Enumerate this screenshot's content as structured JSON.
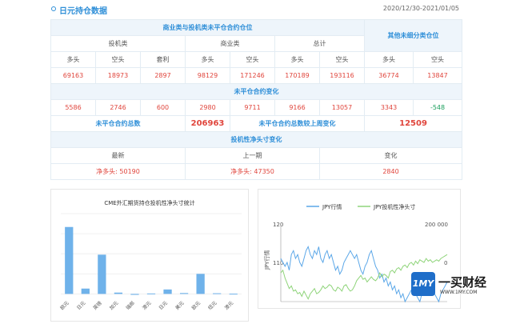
{
  "header": {
    "title": "日元持仓数据",
    "date_range": "2020/12/30-2021/01/05"
  },
  "table": {
    "group_title": "商业类与投机类未平仓合约仓位",
    "other_title": "其他未细分类仓位",
    "col_groups": [
      "投机类",
      "商业类",
      "总计"
    ],
    "sub_headers": [
      "多头",
      "空头",
      "套利",
      "多头",
      "空头",
      "多头",
      "空头",
      "多头",
      "空头"
    ],
    "values": [
      "69163",
      "18973",
      "2897",
      "98129",
      "171246",
      "170189",
      "193116",
      "36774",
      "13847"
    ],
    "change_title": "未平仓合约变化",
    "changes": [
      "5586",
      "2746",
      "600",
      "2980",
      "9711",
      "9166",
      "13057",
      "3343",
      "-548"
    ],
    "total_label": "未平仓合约总数",
    "total_value": "206963",
    "weekly_label": "未平仓合约总数较上周变化",
    "weekly_value": "12509",
    "spec_title": "投机性净头寸变化",
    "spec_headers": [
      "最新",
      "上一期",
      "变化"
    ],
    "spec_latest": "净多头: 50190",
    "spec_prev": "净多头: 47350",
    "spec_change": "2840"
  },
  "bar_chart": {
    "title": "CME外汇期货持仓投机性净头寸统计",
    "chart_data": {
      "type": "bar",
      "title": "CME外汇期货持仓投机性净头寸统计",
      "categories": [
        "欧元",
        "日元",
        "英镑",
        "加元",
        "瑞郎",
        "澳元",
        "日元",
        "美元",
        "欧元",
        "纽元",
        "澳元"
      ],
      "values": [
        150000,
        12000,
        88000,
        3000,
        -2000,
        1000,
        10000,
        2000,
        45000,
        1500,
        500
      ],
      "ylim": [
        -10000,
        180000
      ]
    }
  },
  "line_chart": {
    "legend": [
      "JPY行情",
      "JPY投机性净头寸"
    ],
    "left_ticks": [
      "120",
      "110"
    ],
    "right_ticks": [
      "200 000",
      "0"
    ],
    "left_axis_label": "JPY行情",
    "colors": {
      "jpy": "#5ba7e8",
      "net": "#8fd47a"
    },
    "chart_data": {
      "type": "line",
      "series": [
        {
          "name": "JPY行情",
          "values": [
            111,
            110,
            109,
            110,
            108,
            112,
            113,
            111,
            112,
            110,
            109,
            111,
            113,
            114,
            112,
            111,
            113,
            112,
            114,
            111,
            110,
            112,
            113,
            111,
            112,
            110,
            108,
            109,
            107,
            108,
            110,
            111,
            112,
            113,
            112,
            111,
            112,
            110,
            108,
            107,
            109,
            110,
            112,
            113,
            111,
            109,
            108,
            106,
            107,
            105,
            106,
            104,
            105,
            103,
            104,
            102,
            103,
            101,
            102,
            100,
            101,
            102,
            103,
            104,
            102,
            101,
            100,
            102,
            103,
            104,
            105,
            104,
            103,
            102,
            101,
            100,
            102,
            103,
            104,
            105
          ]
        },
        {
          "name": "JPY投机性净头寸",
          "values": [
            10000,
            20000,
            -10000,
            -30000,
            -50000,
            -40000,
            -60000,
            -55000,
            -70000,
            -65000,
            -80000,
            -60000,
            -75000,
            -90000,
            -70000,
            -60000,
            -50000,
            -70000,
            -65000,
            -55000,
            -40000,
            -50000,
            -45000,
            -35000,
            -40000,
            -55000,
            -60000,
            -45000,
            -50000,
            -60000,
            -40000,
            -35000,
            -50000,
            -60000,
            -55000,
            -40000,
            -20000,
            -10000,
            0,
            -15000,
            -10000,
            -25000,
            -15000,
            -5000,
            -15000,
            -20000,
            -10000,
            10000,
            -5000,
            5000,
            0,
            -10000,
            15000,
            20000,
            10000,
            25000,
            30000,
            20000,
            35000,
            40000,
            30000,
            45000,
            50000,
            40000,
            55000,
            45000,
            60000,
            55000,
            50000,
            65000,
            55000,
            60000,
            50000,
            55000,
            60000,
            55000,
            65000,
            70000,
            75000,
            80000
          ]
        }
      ],
      "ylim_left": [
        100,
        120
      ],
      "ylim_right": [
        -100000,
        200000
      ]
    }
  },
  "watermark": {
    "logo": "1MY",
    "text": "一买财经",
    "url": "WWW.1MY.COM"
  }
}
